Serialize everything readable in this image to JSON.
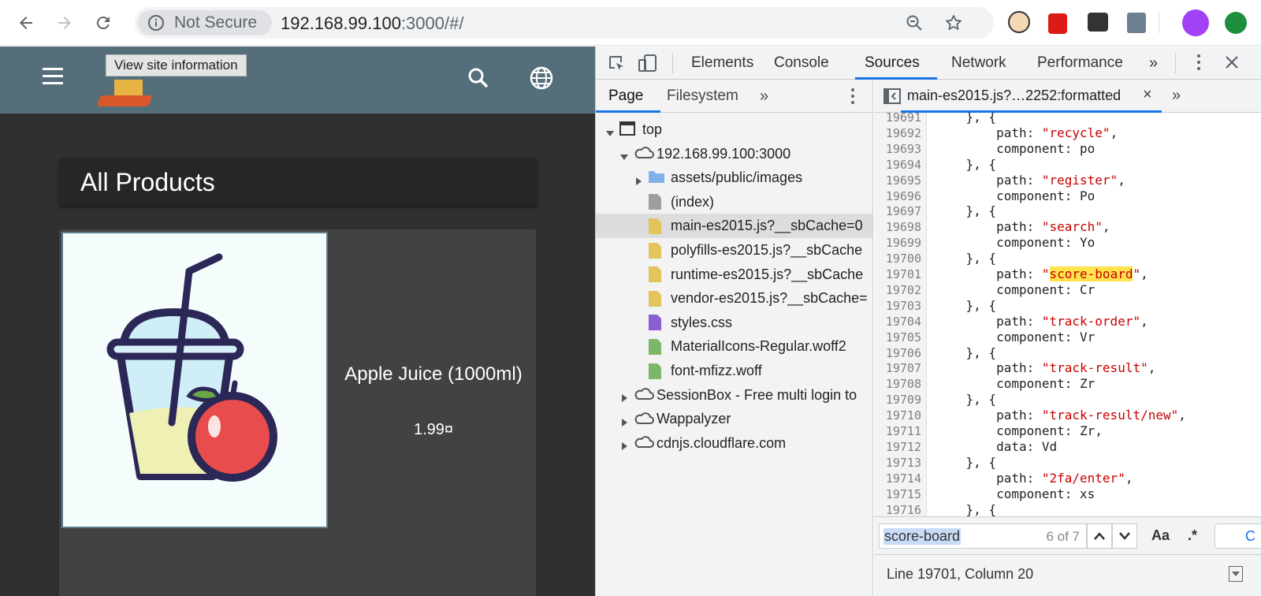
{
  "browser": {
    "security_label": "Not Secure",
    "url_host": "192.168.99.100",
    "url_path": ":3000/#/"
  },
  "page": {
    "tooltip": "View site information",
    "section_title": "All Products",
    "product": {
      "name": "Apple Juice (1000ml)",
      "price": "1.99¤"
    }
  },
  "devtools": {
    "tabs": [
      "Elements",
      "Console",
      "Sources",
      "Network",
      "Performance"
    ],
    "active_tab": "Sources",
    "navigator": {
      "tabs": [
        "Page",
        "Filesystem"
      ],
      "active_tab": "Page",
      "tree": [
        {
          "label": "top",
          "icon": "frame-icon",
          "indent": 0,
          "expanded": true
        },
        {
          "label": "192.168.99.100:3000",
          "icon": "cloud-icon",
          "indent": 1,
          "expanded": true
        },
        {
          "label": "assets/public/images",
          "icon": "folder-icon",
          "indent": 2,
          "expanded": false
        },
        {
          "label": "(index)",
          "icon": "file-gray-icon",
          "indent": 2
        },
        {
          "label": "main-es2015.js?__sbCache=0",
          "icon": "file-yellow-icon",
          "indent": 2,
          "selected": true
        },
        {
          "label": "polyfills-es2015.js?__sbCache",
          "icon": "file-yellow-icon",
          "indent": 2
        },
        {
          "label": "runtime-es2015.js?__sbCache",
          "icon": "file-yellow-icon",
          "indent": 2
        },
        {
          "label": "vendor-es2015.js?__sbCache=",
          "icon": "file-yellow-icon",
          "indent": 2
        },
        {
          "label": "styles.css",
          "icon": "file-purple-icon",
          "indent": 2
        },
        {
          "label": "MaterialIcons-Regular.woff2",
          "icon": "file-green-icon",
          "indent": 2
        },
        {
          "label": "font-mfizz.woff",
          "icon": "file-green-icon",
          "indent": 2
        },
        {
          "label": "SessionBox - Free multi login to",
          "icon": "cloud-icon",
          "indent": 1,
          "expanded": false
        },
        {
          "label": "Wappalyzer",
          "icon": "cloud-icon",
          "indent": 1,
          "expanded": false
        },
        {
          "label": "cdnjs.cloudflare.com",
          "icon": "cloud-icon",
          "indent": 1,
          "expanded": false
        }
      ]
    },
    "editor": {
      "tab_label": "main-es2015.js?…2252:formatted",
      "lines": [
        {
          "n": "19691",
          "pre": "    }, {",
          "str": "",
          "post": ""
        },
        {
          "n": "19692",
          "pre": "        path: ",
          "str": "\"recycle\"",
          "post": ","
        },
        {
          "n": "19693",
          "pre": "        component: po",
          "str": "",
          "post": ""
        },
        {
          "n": "19694",
          "pre": "    }, {",
          "str": "",
          "post": ""
        },
        {
          "n": "19695",
          "pre": "        path: ",
          "str": "\"register\"",
          "post": ","
        },
        {
          "n": "19696",
          "pre": "        component: Po",
          "str": "",
          "post": ""
        },
        {
          "n": "19697",
          "pre": "    }, {",
          "str": "",
          "post": ""
        },
        {
          "n": "19698",
          "pre": "        path: ",
          "str": "\"search\"",
          "post": ","
        },
        {
          "n": "19699",
          "pre": "        component: Yo",
          "str": "",
          "post": ""
        },
        {
          "n": "19700",
          "pre": "    }, {",
          "str": "",
          "post": ""
        },
        {
          "n": "19701",
          "pre": "        path: ",
          "str": "\"score-board\"",
          "post": ",",
          "highlight": "score-board"
        },
        {
          "n": "19702",
          "pre": "        component: Cr",
          "str": "",
          "post": ""
        },
        {
          "n": "19703",
          "pre": "    }, {",
          "str": "",
          "post": ""
        },
        {
          "n": "19704",
          "pre": "        path: ",
          "str": "\"track-order\"",
          "post": ","
        },
        {
          "n": "19705",
          "pre": "        component: Vr",
          "str": "",
          "post": ""
        },
        {
          "n": "19706",
          "pre": "    }, {",
          "str": "",
          "post": ""
        },
        {
          "n": "19707",
          "pre": "        path: ",
          "str": "\"track-result\"",
          "post": ","
        },
        {
          "n": "19708",
          "pre": "        component: Zr",
          "str": "",
          "post": ""
        },
        {
          "n": "19709",
          "pre": "    }, {",
          "str": "",
          "post": ""
        },
        {
          "n": "19710",
          "pre": "        path: ",
          "str": "\"track-result/new\"",
          "post": ","
        },
        {
          "n": "19711",
          "pre": "        component: Zr,",
          "str": "",
          "post": ""
        },
        {
          "n": "19712",
          "pre": "        data: Vd",
          "str": "",
          "post": ""
        },
        {
          "n": "19713",
          "pre": "    }, {",
          "str": "",
          "post": ""
        },
        {
          "n": "19714",
          "pre": "        path: ",
          "str": "\"2fa/enter\"",
          "post": ","
        },
        {
          "n": "19715",
          "pre": "        component: xs",
          "str": "",
          "post": ""
        },
        {
          "n": "19716",
          "pre": "    }, {",
          "str": "",
          "post": ""
        }
      ]
    },
    "search": {
      "query": "score-board",
      "match_count": "6 of 7",
      "case_label": "Aa",
      "regex_label": ".*",
      "cancel_label": "C"
    },
    "status": "Line 19701, Column 20"
  }
}
